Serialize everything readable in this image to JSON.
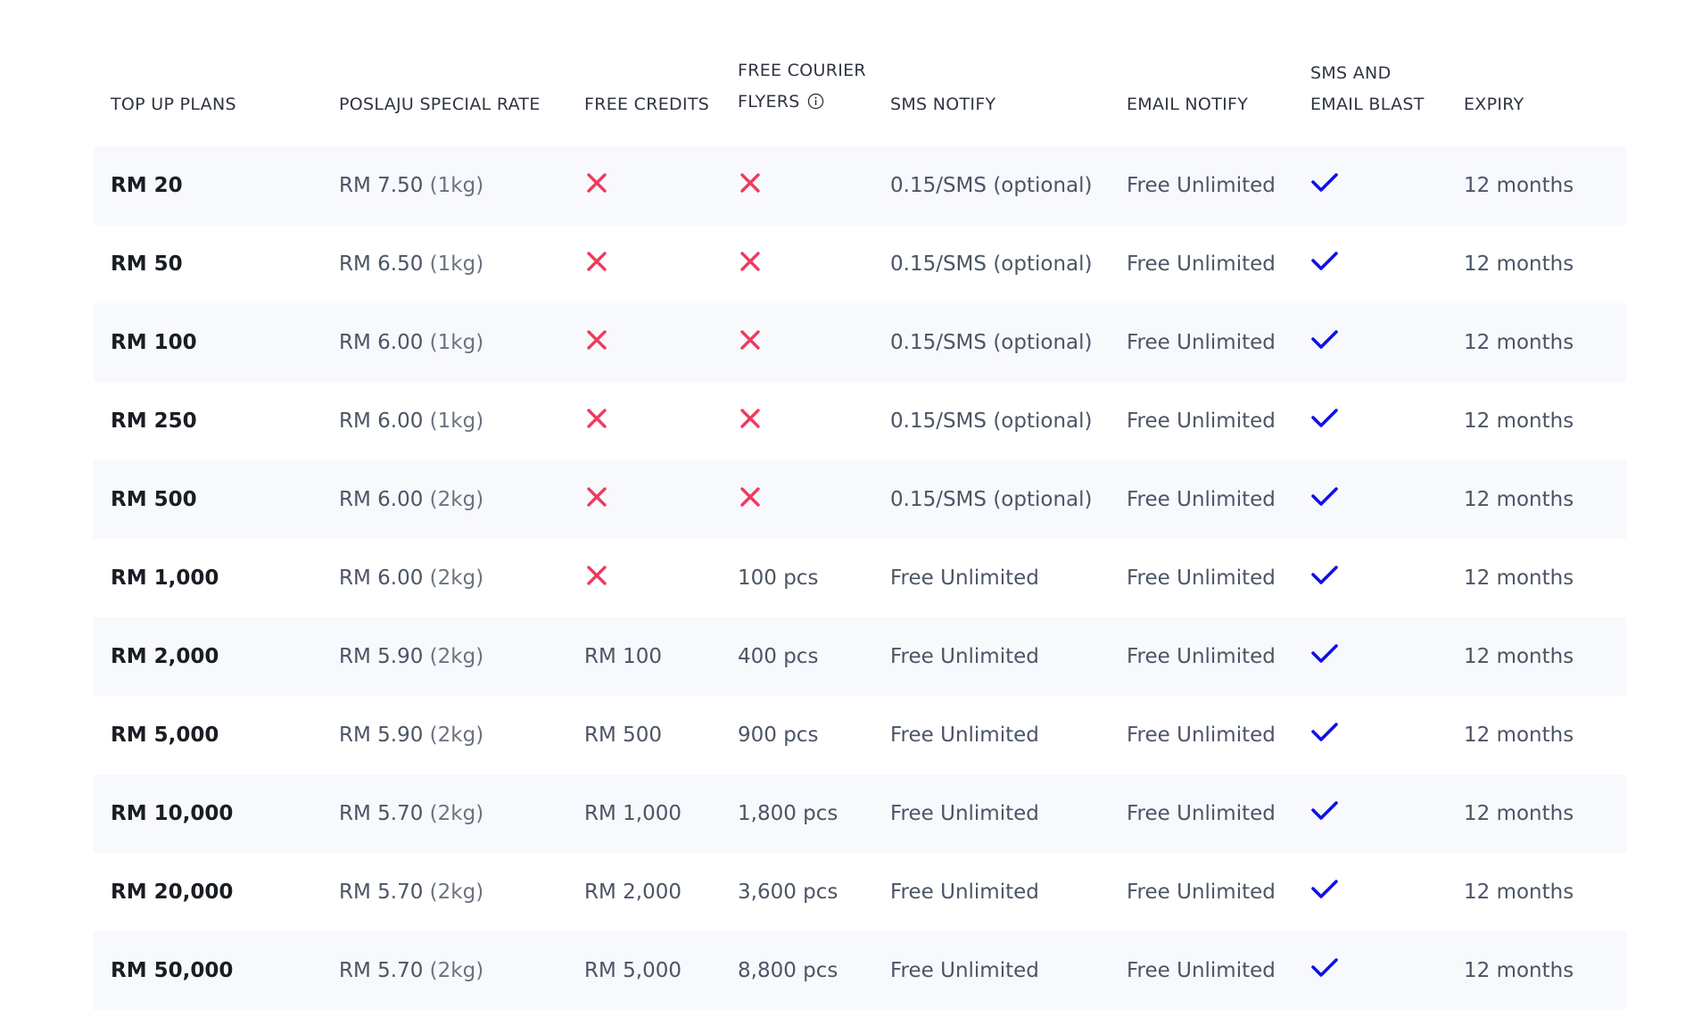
{
  "colors": {
    "cross": "#ee3b5d",
    "check": "#1010e6",
    "row_shade": "#f8f9fd"
  },
  "headers": {
    "plans": "TOP UP PLANS",
    "rate": "POSLAJU SPECIAL RATE",
    "credits": "FREE CREDITS",
    "flyers_line1": "FREE COURIER",
    "flyers_line2": "FLYERS",
    "sms": "SMS NOTIFY",
    "email": "EMAIL NOTIFY",
    "blast_line1": "SMS AND",
    "blast_line2": "EMAIL BLAST",
    "expiry": "EXPIRY"
  },
  "icons": {
    "info": "info-circle-icon",
    "yes": "check-icon",
    "no": "cross-icon"
  },
  "rows": [
    {
      "plan": "RM 20",
      "rate": "RM 7.50",
      "weight": "(1kg)",
      "credits": null,
      "flyers": null,
      "sms": "0.15/SMS (optional)",
      "email": "Free Unlimited",
      "blast": true,
      "expiry": "12 months"
    },
    {
      "plan": "RM 50",
      "rate": "RM 6.50",
      "weight": "(1kg)",
      "credits": null,
      "flyers": null,
      "sms": "0.15/SMS (optional)",
      "email": "Free Unlimited",
      "blast": true,
      "expiry": "12 months"
    },
    {
      "plan": "RM 100",
      "rate": "RM 6.00",
      "weight": "(1kg)",
      "credits": null,
      "flyers": null,
      "sms": "0.15/SMS (optional)",
      "email": "Free Unlimited",
      "blast": true,
      "expiry": "12 months"
    },
    {
      "plan": "RM 250",
      "rate": "RM 6.00",
      "weight": "(1kg)",
      "credits": null,
      "flyers": null,
      "sms": "0.15/SMS (optional)",
      "email": "Free Unlimited",
      "blast": true,
      "expiry": "12 months"
    },
    {
      "plan": "RM 500",
      "rate": "RM 6.00",
      "weight": "(2kg)",
      "credits": null,
      "flyers": null,
      "sms": "0.15/SMS (optional)",
      "email": "Free Unlimited",
      "blast": true,
      "expiry": "12 months"
    },
    {
      "plan": "RM 1,000",
      "rate": "RM 6.00",
      "weight": "(2kg)",
      "credits": null,
      "flyers": "100 pcs",
      "sms": "Free Unlimited",
      "email": "Free Unlimited",
      "blast": true,
      "expiry": "12 months"
    },
    {
      "plan": "RM 2,000",
      "rate": "RM 5.90",
      "weight": "(2kg)",
      "credits": "RM 100",
      "flyers": "400 pcs",
      "sms": "Free Unlimited",
      "email": "Free Unlimited",
      "blast": true,
      "expiry": "12 months"
    },
    {
      "plan": "RM 5,000",
      "rate": "RM 5.90",
      "weight": "(2kg)",
      "credits": "RM 500",
      "flyers": "900 pcs",
      "sms": "Free Unlimited",
      "email": "Free Unlimited",
      "blast": true,
      "expiry": "12 months"
    },
    {
      "plan": "RM 10,000",
      "rate": "RM 5.70",
      "weight": "(2kg)",
      "credits": "RM 1,000",
      "flyers": "1,800 pcs",
      "sms": "Free Unlimited",
      "email": "Free Unlimited",
      "blast": true,
      "expiry": "12 months"
    },
    {
      "plan": "RM 20,000",
      "rate": "RM 5.70",
      "weight": "(2kg)",
      "credits": "RM 2,000",
      "flyers": "3,600 pcs",
      "sms": "Free Unlimited",
      "email": "Free Unlimited",
      "blast": true,
      "expiry": "12 months"
    },
    {
      "plan": "RM 50,000",
      "rate": "RM 5.70",
      "weight": "(2kg)",
      "credits": "RM 5,000",
      "flyers": "8,800 pcs",
      "sms": "Free Unlimited",
      "email": "Free Unlimited",
      "blast": true,
      "expiry": "12 months"
    }
  ]
}
